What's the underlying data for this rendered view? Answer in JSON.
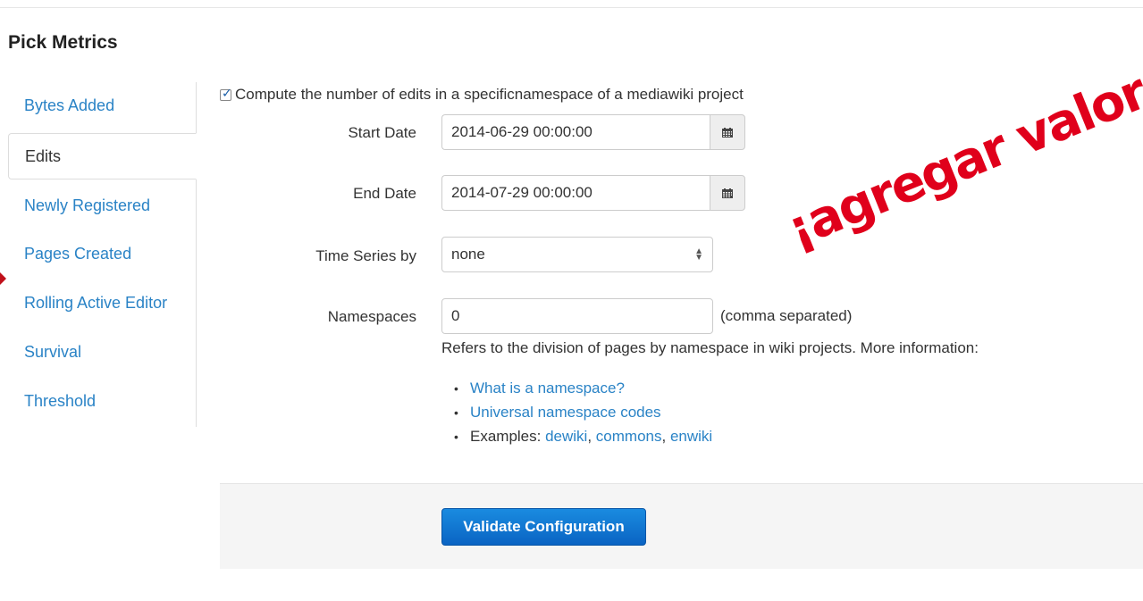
{
  "section": {
    "title": "Pick Metrics"
  },
  "tabs": [
    {
      "label": "Bytes Added",
      "active": false
    },
    {
      "label": "Edits",
      "active": true
    },
    {
      "label": "Newly Registered",
      "active": false
    },
    {
      "label": "Pages Created",
      "active": false
    },
    {
      "label": "Rolling Active Editor",
      "active": false
    },
    {
      "label": "Survival",
      "active": false
    },
    {
      "label": "Threshold",
      "active": false
    }
  ],
  "form": {
    "checkbox_label": "Compute the number of edits in a specificnamespace of a mediawiki project",
    "checkbox_checked": true,
    "start_date": {
      "label": "Start Date",
      "value": "2014-06-29 00:00:00",
      "icon": "calendar-icon"
    },
    "end_date": {
      "label": "End Date",
      "value": "2014-07-29 00:00:00",
      "icon": "calendar-icon"
    },
    "time_series": {
      "label": "Time Series by",
      "value": "none"
    },
    "namespaces": {
      "label": "Namespaces",
      "value": "0",
      "hint": "(comma separated)",
      "help": "Refers to the division of pages by namespace in wiki projects. More information:",
      "links": {
        "what_is": "What is a namespace?",
        "codes": "Universal namespace codes",
        "examples_prefix": "Examples: ",
        "dewiki": "dewiki",
        "commons": "commons",
        "enwiki": "enwiki",
        "sep": ", "
      }
    }
  },
  "footer": {
    "validate_label": "Validate Configuration"
  },
  "annotation": {
    "text": "¡agregar valores",
    "color": "#e0001b"
  },
  "colors": {
    "link": "#2a83c6",
    "primary_button": "#0a64c3",
    "footer_bg": "#f5f5f5"
  }
}
